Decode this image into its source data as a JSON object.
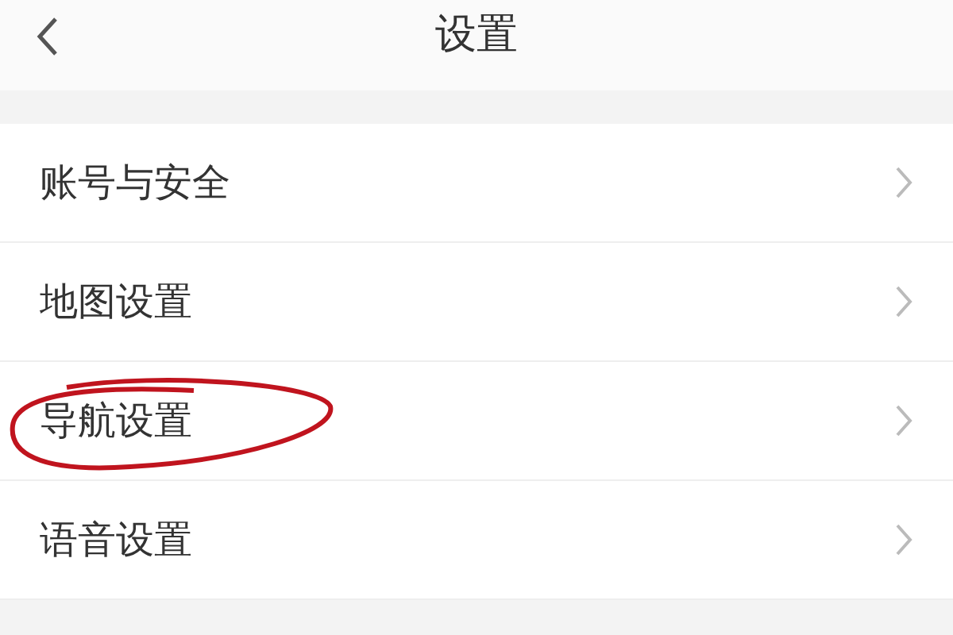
{
  "header": {
    "title": "设置"
  },
  "items": [
    {
      "label": "账号与安全",
      "circled": false
    },
    {
      "label": "地图设置",
      "circled": false
    },
    {
      "label": "导航设置",
      "circled": true
    },
    {
      "label": "语音设置",
      "circled": false
    }
  ]
}
